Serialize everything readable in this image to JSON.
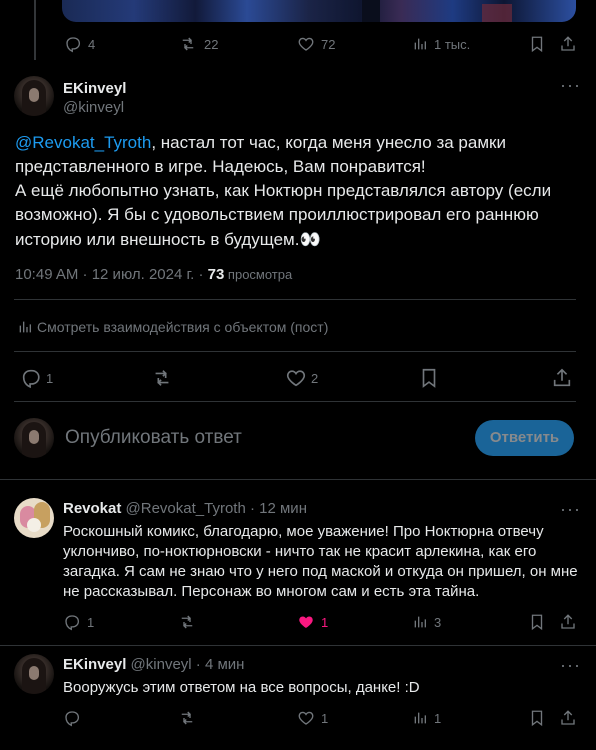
{
  "colors": {
    "background": "#000000",
    "accent": "#1d9bf0",
    "like_active": "#f91880",
    "text": "#e7e9ea",
    "muted": "#71767b",
    "border": "#2f3336"
  },
  "parent_post": {
    "actions": {
      "reply_count": "4",
      "repost_count": "22",
      "like_count": "72",
      "view_count": "1 тыс."
    }
  },
  "main_post": {
    "author_name": "EKinveyl",
    "author_handle": "@kinveyl",
    "mention": "@Revokat_Tyroth",
    "line1_rest": ", настал тот час, когда меня унесло за рамки",
    "line2": "представленного в игре. Надеюсь, Вам понравится!",
    "line3": "А ещё любопытно узнать, как Ноктюрн представлялся автору (если",
    "line4": "возможно). Я бы с удовольствием проиллюстрировал его раннюю",
    "line5": "историю или внешность в будущем.👀",
    "timestamp": "10:49 AM · 12 июл. 2024 г. · ",
    "views_number": "73",
    "views_label": " просмотра",
    "interactions_label": "Смотреть взаимодействия с объектом (пост)",
    "actions": {
      "reply_count": "1",
      "like_count": "2"
    }
  },
  "composer": {
    "placeholder": "Опубликовать ответ",
    "button_label": "Ответить"
  },
  "replies": [
    {
      "author_name": "Revokat",
      "author_handle": "@Revokat_Tyroth",
      "time": "· 12 мин",
      "lines": [
        "Роскошный комикс, благодарю, мое уважение! Про Ноктюрна отвечу",
        "уклончиво, по-ноктюрновски - ничто так не красит арлекина, как его",
        "загадка. Я сам не знаю что у него под маской и откуда он пришел, он мне",
        "не рассказывал. Персонаж во многом сам и есть эта тайна."
      ],
      "actions": {
        "reply_count": "1",
        "like_count": "1",
        "view_count": "3"
      }
    },
    {
      "author_name": "EKinveyl",
      "author_handle": "@kinveyl",
      "time": "· 4 мин",
      "lines": [
        "Вооружусь этим ответом на все вопросы, данке! :D"
      ],
      "actions": {
        "like_count": "1",
        "view_count": "1"
      }
    }
  ]
}
